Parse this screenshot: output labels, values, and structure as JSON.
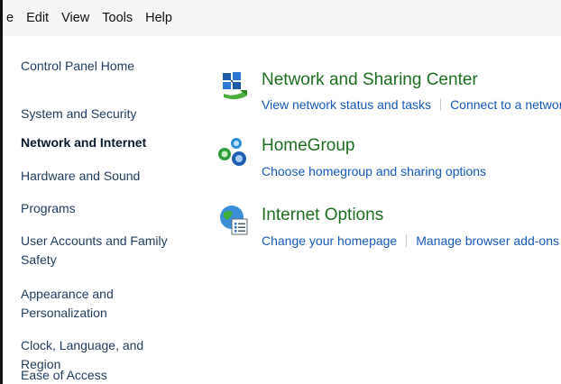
{
  "menubar": {
    "items": [
      {
        "label": "e",
        "name": "menu-file"
      },
      {
        "label": "Edit",
        "name": "menu-edit"
      },
      {
        "label": "View",
        "name": "menu-view"
      },
      {
        "label": "Tools",
        "name": "menu-tools"
      },
      {
        "label": "Help",
        "name": "menu-help"
      }
    ]
  },
  "sidebar": {
    "home": "Control Panel Home",
    "items": [
      {
        "label": "System and Security"
      },
      {
        "label": "Network and Internet",
        "current": true
      },
      {
        "label": "Hardware and Sound"
      },
      {
        "label": "Programs"
      },
      {
        "label": "User Accounts and Family Safety"
      },
      {
        "label": "Appearance and Personalization"
      },
      {
        "label": "Clock, Language, and Region"
      },
      {
        "label": "Ease of Access"
      }
    ]
  },
  "categories": [
    {
      "title": "Network and Sharing Center",
      "icon": "network-sharing-icon",
      "links": [
        "View network status and tasks",
        "Connect to a networ"
      ]
    },
    {
      "title": "HomeGroup",
      "icon": "homegroup-icon",
      "links": [
        "Choose homegroup and sharing options"
      ]
    },
    {
      "title": "Internet Options",
      "icon": "internet-options-icon",
      "links": [
        "Change your homepage",
        "Manage browser add-ons"
      ]
    }
  ],
  "colors": {
    "title_green": "#1e6e22",
    "link_blue": "#1659b8",
    "sidebar_text": "#1e3b5c",
    "menubar_bg": "#f5f5f5"
  }
}
